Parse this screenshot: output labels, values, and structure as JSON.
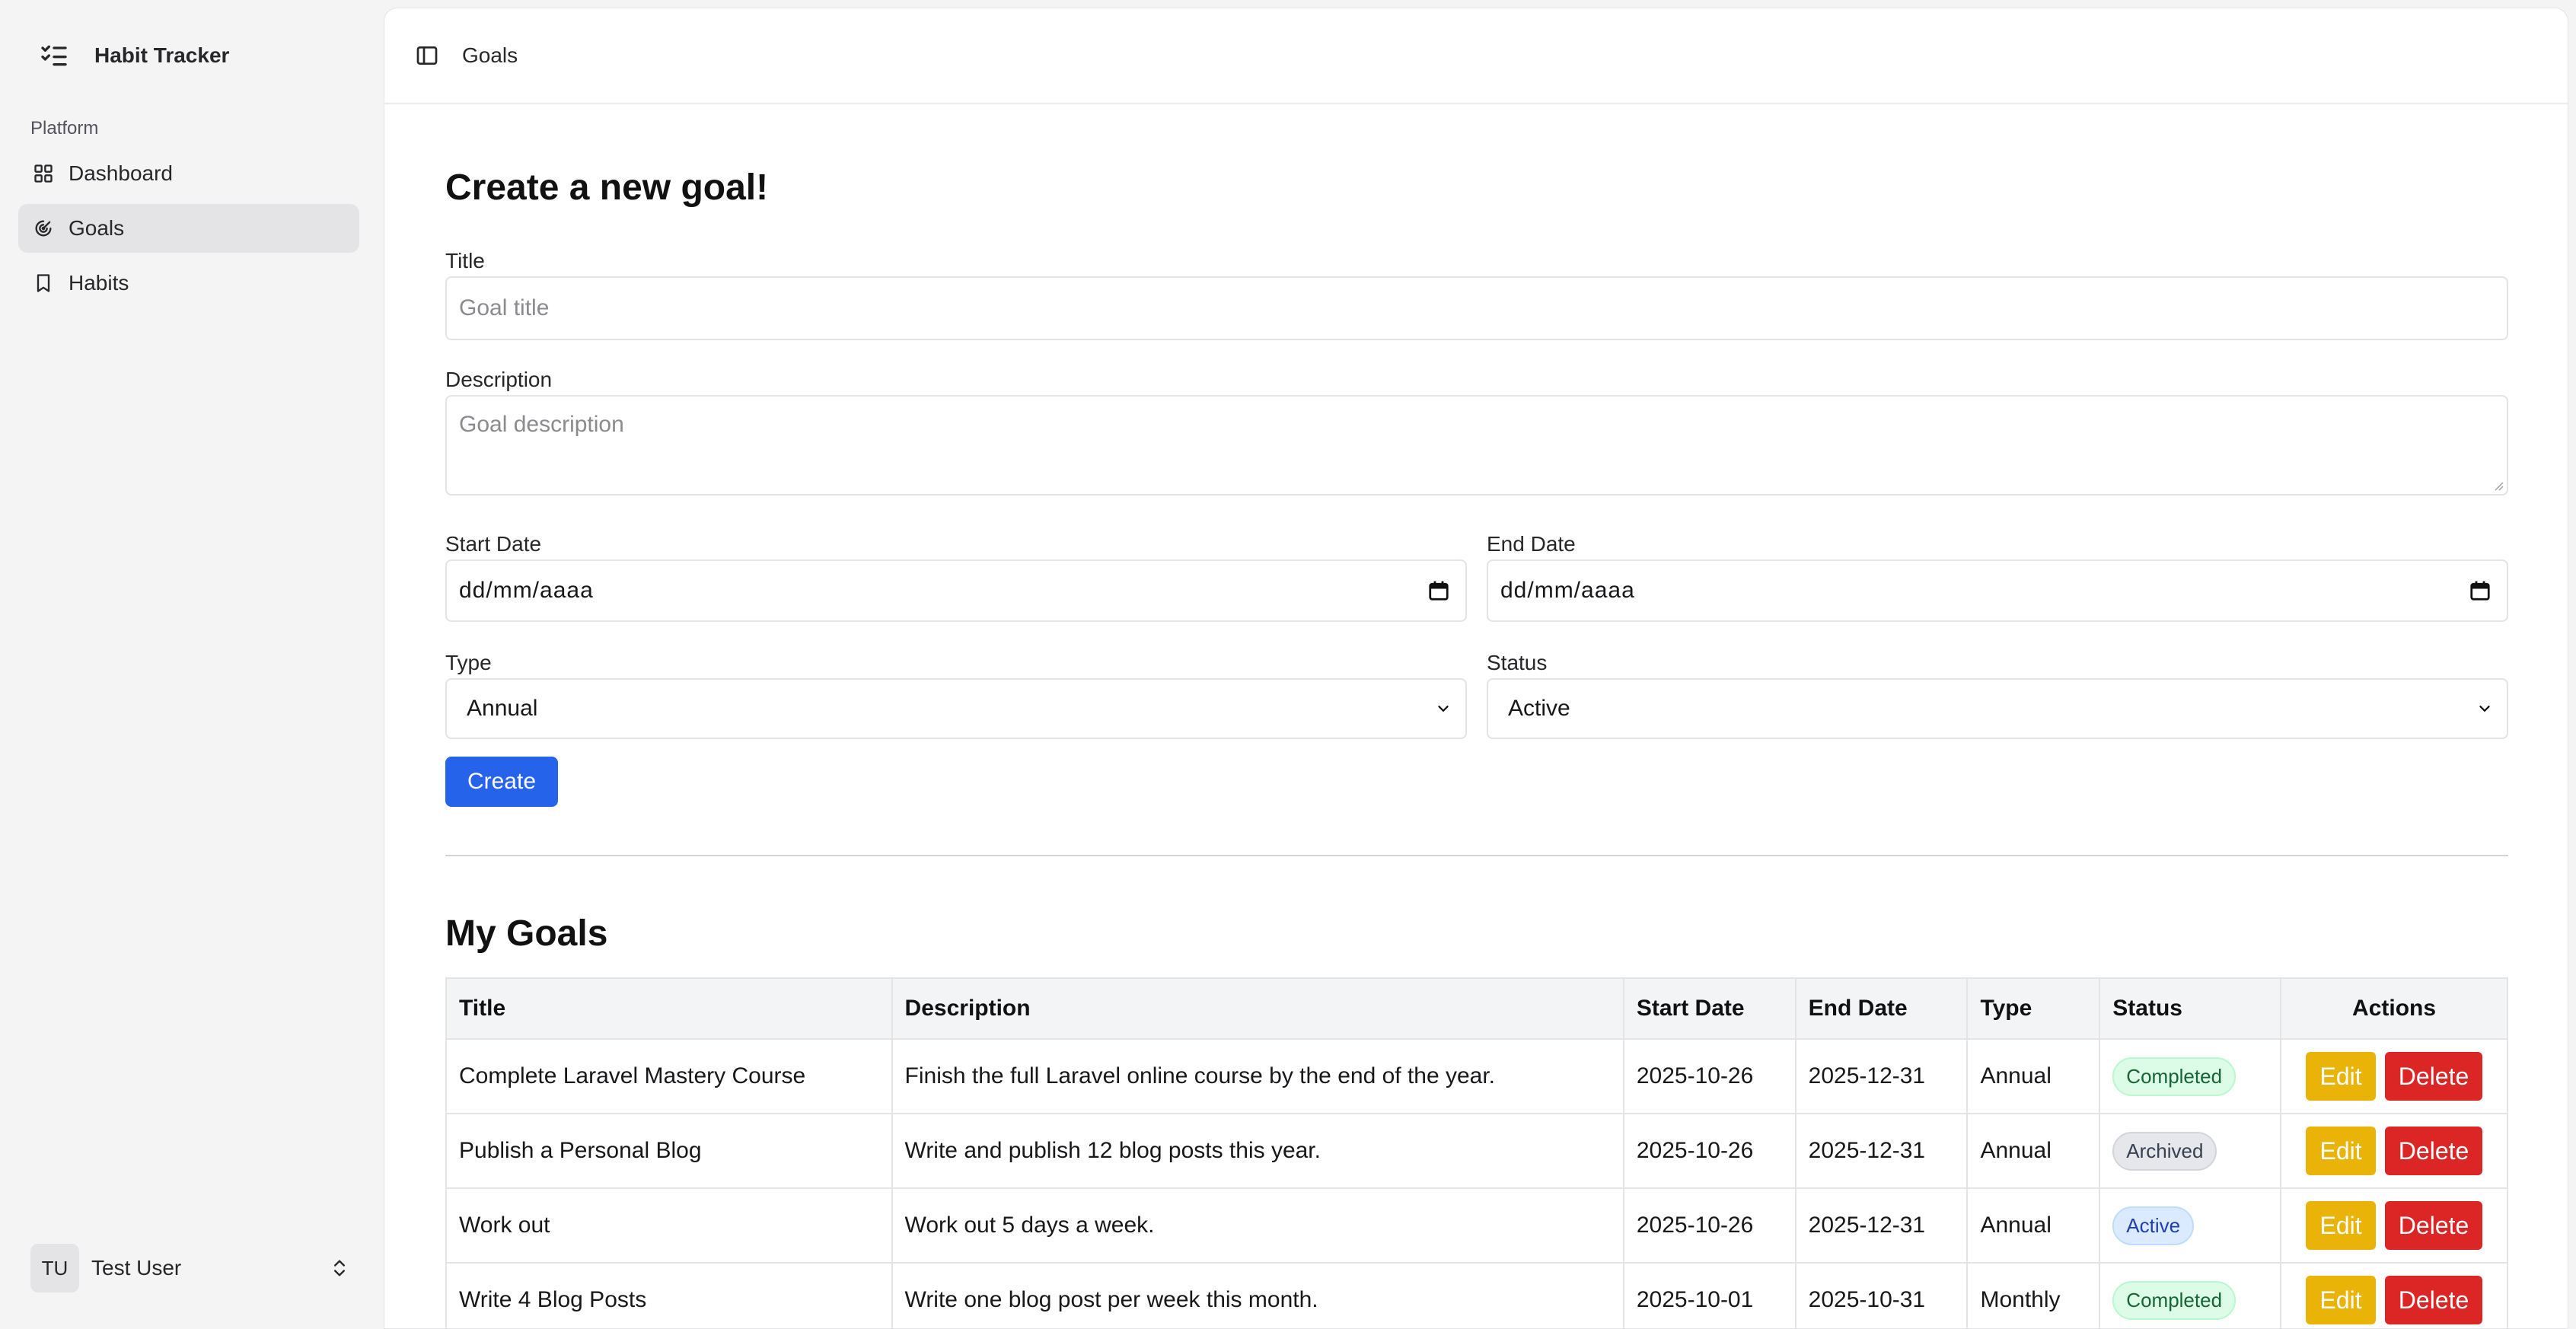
{
  "sidebar": {
    "brand_icon": "list-checks-icon",
    "brand_title": "Habit Tracker",
    "section_label": "Platform",
    "items": [
      {
        "label": "Dashboard",
        "icon": "grid-icon",
        "active": false
      },
      {
        "label": "Goals",
        "icon": "target-icon",
        "active": true
      },
      {
        "label": "Habits",
        "icon": "bookmark-icon",
        "active": false
      }
    ],
    "user": {
      "initials": "TU",
      "name": "Test User"
    }
  },
  "topbar": {
    "breadcrumb": "Goals"
  },
  "form": {
    "heading": "Create a new goal!",
    "title_label": "Title",
    "title_placeholder": "Goal title",
    "description_label": "Description",
    "description_placeholder": "Goal description",
    "start_date_label": "Start Date",
    "start_date_value": "dd/mm/aaaa",
    "end_date_label": "End Date",
    "end_date_value": "dd/mm/aaaa",
    "type_label": "Type",
    "type_value": "Annual",
    "status_label": "Status",
    "status_value": "Active",
    "submit_label": "Create"
  },
  "goals": {
    "heading": "My Goals",
    "columns": [
      "Title",
      "Description",
      "Start Date",
      "End Date",
      "Type",
      "Status",
      "Actions"
    ],
    "edit_label": "Edit",
    "delete_label": "Delete",
    "rows": [
      {
        "title": "Complete Laravel Mastery Course",
        "description": "Finish the full Laravel online course by the end of the year.",
        "start": "2025-10-26",
        "end": "2025-12-31",
        "type": "Annual",
        "status": "Completed"
      },
      {
        "title": "Publish a Personal Blog",
        "description": "Write and publish 12 blog posts this year.",
        "start": "2025-10-26",
        "end": "2025-12-31",
        "type": "Annual",
        "status": "Archived"
      },
      {
        "title": "Work out",
        "description": "Work out 5 days a week.",
        "start": "2025-10-26",
        "end": "2025-12-31",
        "type": "Annual",
        "status": "Active"
      },
      {
        "title": "Write 4 Blog Posts",
        "description": "Write one blog post per week this month.",
        "start": "2025-10-01",
        "end": "2025-10-31",
        "type": "Monthly",
        "status": "Completed"
      }
    ]
  },
  "colors": {
    "primary": "#2563eb",
    "edit": "#eab308",
    "delete": "#dc2626"
  }
}
